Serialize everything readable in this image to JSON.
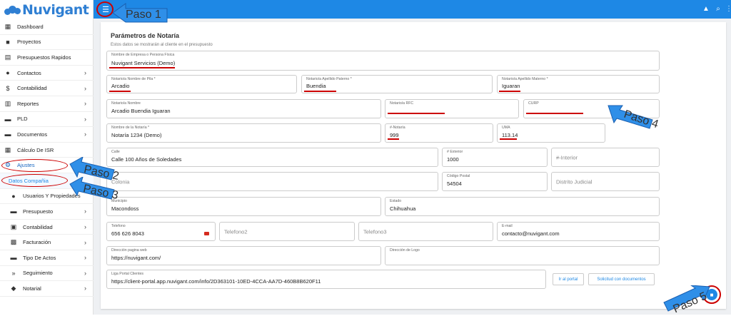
{
  "app": {
    "logo_text": "Nuvigant"
  },
  "sidebar": {
    "items": [
      {
        "label": "Dashboard",
        "icon": "dashboard-icon"
      },
      {
        "label": "Proyectos",
        "icon": "briefcase-icon"
      },
      {
        "label": "Presupuestos Rapidos",
        "icon": "document-icon"
      },
      {
        "label": "Contactos",
        "icon": "person-icon"
      },
      {
        "label": "Contabilidad",
        "icon": "dollar-icon"
      },
      {
        "label": "Reportes",
        "icon": "chart-icon"
      },
      {
        "label": "PLD",
        "icon": "folder-icon"
      },
      {
        "label": "Documentos",
        "icon": "folder-icon"
      },
      {
        "label": "Cálculo De ISR",
        "icon": "calculator-icon"
      },
      {
        "label": "Ajustes",
        "icon": "gear-icon"
      },
      {
        "label": "Datos Compañia",
        "icon": ""
      },
      {
        "label": "Usuarios Y Propiedades",
        "icon": "person-icon"
      },
      {
        "label": "Presupuesto",
        "icon": "folder-icon"
      },
      {
        "label": "Contabilidad",
        "icon": "wallet-icon"
      },
      {
        "label": "Facturación",
        "icon": "qr-icon"
      },
      {
        "label": "Tipo De Actos",
        "icon": "folder-icon"
      },
      {
        "label": "Seguimiento",
        "icon": "fast-forward-icon"
      },
      {
        "label": "Notarial",
        "icon": "box-icon"
      }
    ]
  },
  "form": {
    "title": "Parámetros de Notaría",
    "subtitle": "Estos datos se mostrarán al cliente en el presupuesto",
    "empresa": {
      "label": "Nombre de Empresa o Persona Física",
      "value": "Nuvigant Servicios (Demo)"
    },
    "nombre_pila": {
      "label": "Notario/a Nombre de Pila *",
      "value": "Arcadio"
    },
    "apellido_paterno": {
      "label": "Notario/a Apellido Paterno *",
      "value": "Buendia"
    },
    "apellido_materno": {
      "label": "Notario/a Apellido Materno *",
      "value": "Iguaran"
    },
    "notario_nombre": {
      "label": "Notario/a Nombre",
      "value": "Arcadio Buendia Iguaran"
    },
    "rfc": {
      "label": "Notario/a RFC",
      "value": ""
    },
    "curp": {
      "label": "CURP",
      "value": ""
    },
    "nombre_notaria": {
      "label": "Nombre de la Notaría *",
      "value": "Notaría 1234 (Demo)"
    },
    "num_notaria": {
      "label": "#-Notaría",
      "value": "999"
    },
    "uma": {
      "label": "UMA",
      "value": "113.14"
    },
    "calle": {
      "label": "Calle",
      "value": "Calle 100 Años de Soledades"
    },
    "num_exterior": {
      "label": "# Exterior",
      "value": "1000"
    },
    "num_interior": {
      "placeholder": "#-Interior"
    },
    "colonia": {
      "placeholder": "Colonia"
    },
    "codigo_postal": {
      "label": "Código Postal",
      "value": "54504"
    },
    "distrito": {
      "placeholder": "Distrito Judicial"
    },
    "municipio": {
      "label": "Municipio",
      "value": "Macondoss"
    },
    "estado": {
      "label": "Estado",
      "value": "Chihuahua"
    },
    "telefono": {
      "label": "Telefono",
      "value": "656 626 8043"
    },
    "telefono2": {
      "placeholder": "Telefono2"
    },
    "telefono3": {
      "placeholder": "Telefono3"
    },
    "email": {
      "label": "E-mail",
      "value": "contacto@nuvigant.com"
    },
    "web": {
      "label": "Dirección pagina web",
      "value": "https://nuvigant.com/"
    },
    "logo": {
      "label": "Dirección de Logo",
      "value": ""
    },
    "liga": {
      "label": "Liga Portal Clientes",
      "value": "https://client-portal.app.nuvigant.com/info/2D363101-10ED-4CCA-AA7D-460B8B620F11"
    },
    "btn_portal": "Ir al portal",
    "btn_solicitud": "Solicitud con documentos"
  },
  "annotations": {
    "paso1": "Paso 1",
    "paso2": "Paso 2",
    "paso3": "Paso 3",
    "paso4": "Paso 4",
    "paso5": "Paso 5"
  },
  "colors": {
    "topbar": "#1e88e5",
    "accent": "#1e88e5",
    "underline": "#cc0000",
    "arrow": "#2f8fe8"
  }
}
